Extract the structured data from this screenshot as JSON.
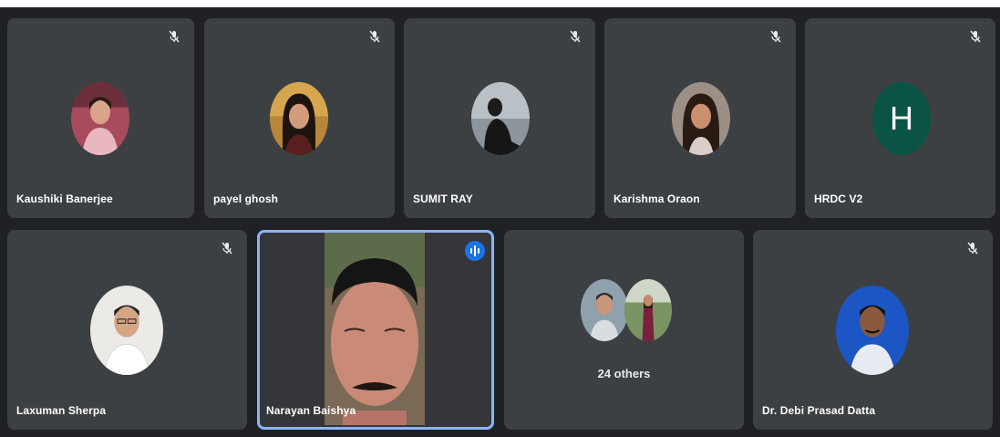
{
  "colors": {
    "stage_bg": "#202124",
    "tile_bg": "#3c4043",
    "active_border": "#8ab4f8",
    "speaking_badge": "#1a73e8",
    "hrdc_avatar": "#0b5345"
  },
  "participants": [
    {
      "name": "Kaushiki Banerjee",
      "muted": true
    },
    {
      "name": "payel ghosh",
      "muted": true
    },
    {
      "name": "SUMIT RAY",
      "muted": true
    },
    {
      "name": "Karishma Oraon",
      "muted": true
    },
    {
      "name": "HRDC V2",
      "muted": true,
      "initial": "H"
    },
    {
      "name": "Laxuman Sherpa",
      "muted": true
    },
    {
      "name": "Narayan Baishya",
      "muted": false,
      "speaking": true,
      "video_on": true
    },
    {
      "name": "Dr. Debi Prasad Datta",
      "muted": true
    }
  ],
  "others": {
    "label": "24 others"
  }
}
